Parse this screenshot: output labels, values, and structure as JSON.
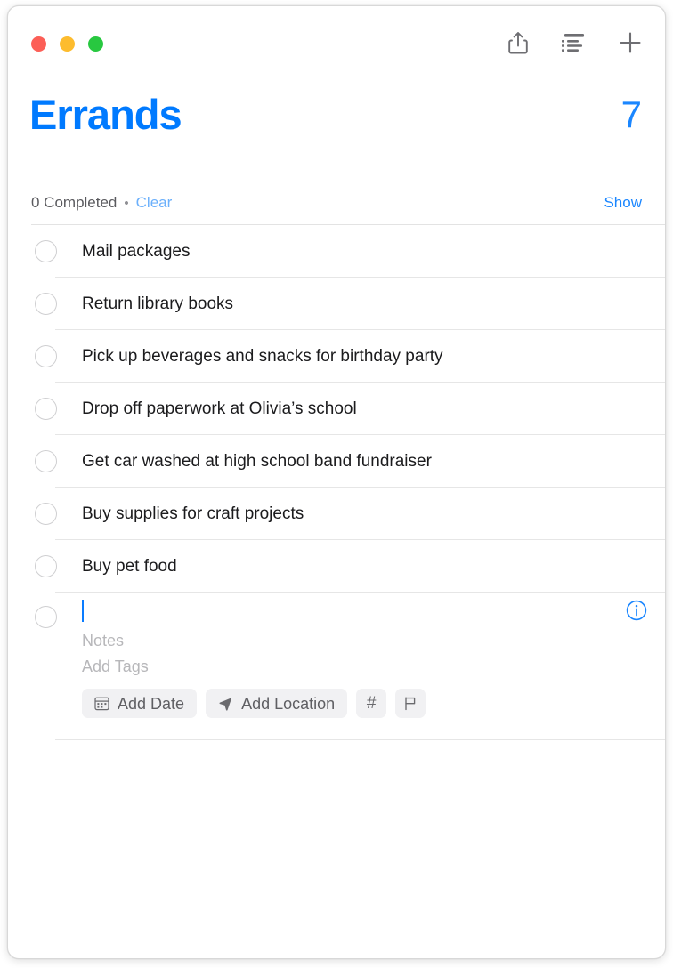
{
  "window": {
    "traffic_lights": [
      {
        "name": "close",
        "color": "#fc5f57"
      },
      {
        "name": "minimize",
        "color": "#fdbc2e"
      },
      {
        "name": "zoom",
        "color": "#28c840"
      }
    ]
  },
  "toolbar": {
    "share_label": "Share",
    "view_options_label": "View Options",
    "add_label": "Add Reminder"
  },
  "header": {
    "title": "Errands",
    "count": "7",
    "title_color": "#007aff",
    "count_color": "#1a86ff"
  },
  "completed_bar": {
    "completed_text": "0 Completed",
    "separator": "•",
    "clear_label": "Clear",
    "show_label": "Show",
    "clear_color": "#6cb0fb",
    "show_color": "#1a86ff"
  },
  "reminders": [
    {
      "title": "Mail packages"
    },
    {
      "title": "Return library books"
    },
    {
      "title": "Pick up beverages and snacks for birthday party"
    },
    {
      "title": "Drop off paperwork at Olivia’s school"
    },
    {
      "title": "Get car washed at high school band fundraiser"
    },
    {
      "title": "Buy supplies for craft projects"
    },
    {
      "title": "Buy pet food"
    }
  ],
  "new_reminder": {
    "title_value": "",
    "notes_placeholder": "Notes",
    "tags_placeholder": "Add Tags",
    "info_label": "Info",
    "actions": [
      {
        "id": "add-date",
        "label": "Add Date",
        "icon": "calendar-icon"
      },
      {
        "id": "add-location",
        "label": "Add Location",
        "icon": "location-arrow-icon"
      },
      {
        "id": "add-tag",
        "label": "#",
        "icon": "hash-icon"
      },
      {
        "id": "add-flag",
        "label": "",
        "icon": "flag-icon"
      }
    ]
  }
}
